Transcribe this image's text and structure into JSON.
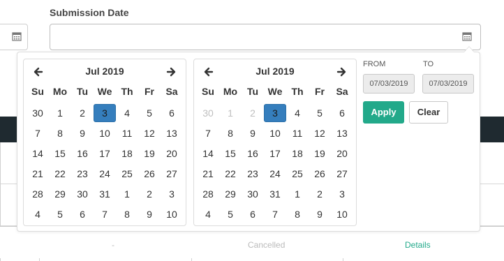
{
  "form": {
    "submission_label": "Submission Date",
    "submission_value": ""
  },
  "table": {
    "bottom_cells": [
      "-",
      "Cancelled",
      "Details"
    ]
  },
  "picker": {
    "left": {
      "title": "Jul 2019",
      "weekdays": [
        "Su",
        "Mo",
        "Tu",
        "We",
        "Th",
        "Fr",
        "Sa"
      ],
      "weeks": [
        [
          "30",
          "1",
          "2",
          "3",
          "4",
          "5",
          "6"
        ],
        [
          "7",
          "8",
          "9",
          "10",
          "11",
          "12",
          "13"
        ],
        [
          "14",
          "15",
          "16",
          "17",
          "18",
          "19",
          "20"
        ],
        [
          "21",
          "22",
          "23",
          "24",
          "25",
          "26",
          "27"
        ],
        [
          "28",
          "29",
          "30",
          "31",
          "1",
          "2",
          "3"
        ],
        [
          "4",
          "5",
          "6",
          "7",
          "8",
          "9",
          "10"
        ]
      ],
      "selected": "3"
    },
    "right": {
      "title": "Jul 2019",
      "weekdays": [
        "Su",
        "Mo",
        "Tu",
        "We",
        "Th",
        "Fr",
        "Sa"
      ],
      "weeks": [
        [
          "30",
          "1",
          "2",
          "3",
          "4",
          "5",
          "6"
        ],
        [
          "7",
          "8",
          "9",
          "10",
          "11",
          "12",
          "13"
        ],
        [
          "14",
          "15",
          "16",
          "17",
          "18",
          "19",
          "20"
        ],
        [
          "21",
          "22",
          "23",
          "24",
          "25",
          "26",
          "27"
        ],
        [
          "28",
          "29",
          "30",
          "31",
          "1",
          "2",
          "3"
        ],
        [
          "4",
          "5",
          "6",
          "7",
          "8",
          "9",
          "10"
        ]
      ],
      "selected": "3"
    },
    "range": {
      "from_label": "FROM",
      "to_label": "TO",
      "from_value": "07/03/2019",
      "to_value": "07/03/2019"
    },
    "apply_label": "Apply",
    "clear_label": "Clear"
  },
  "colors": {
    "accent_green": "#22a98a",
    "selected_blue": "#357ebd"
  },
  "icons": [
    "calendar-icon",
    "chevron-left-icon",
    "chevron-right-icon"
  ]
}
